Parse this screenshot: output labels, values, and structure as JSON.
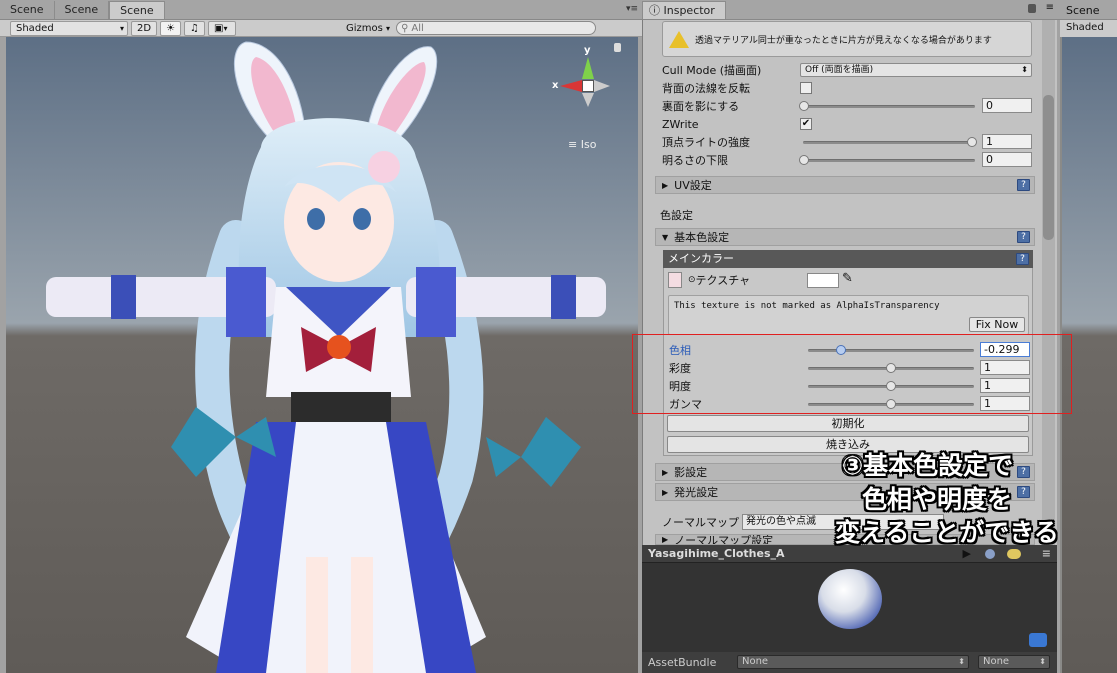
{
  "scene_tabs": [
    "Scene",
    "Scene",
    "Scene"
  ],
  "scene_toolbar": {
    "shading": "Shaded",
    "mode2d": "2D",
    "gizmos": "Gizmos",
    "search_placeholder": "All"
  },
  "gizmo": {
    "y": "y",
    "x": "x",
    "projection": "Iso"
  },
  "inspector": {
    "tab": "Inspector",
    "warning": "透過マテリアル同士が重なったときに片方が見えなくなる場合があります",
    "cull_mode_label": "Cull Mode (描画面)",
    "cull_mode_value": "Off (両面を描画)",
    "backface_normal_label": "背面の法線を反転",
    "shadow_back_label": "裏面を影にする",
    "shadow_back_value": "0",
    "zwrite_label": "ZWrite",
    "vertex_light_label": "頂点ライトの強度",
    "vertex_light_value": "1",
    "min_brightness_label": "明るさの下限",
    "min_brightness_value": "0",
    "uv_section": "UV設定",
    "color_header": "色設定",
    "base_color_section": "基本色設定",
    "main_color_box": "メインカラー",
    "texture_label": "テクスチャ",
    "alpha_warning": "This texture is not marked as AlphaIsTransparency",
    "fix_now": "Fix Now",
    "hue_label": "色相",
    "hue_value": "-0.299",
    "hue_level": 0.2,
    "saturation_label": "彩度",
    "saturation_value": "1",
    "saturation_level": 0.5,
    "brightness_label": "明度",
    "brightness_value": "1",
    "brightness_level": 0.5,
    "gamma_label": "ガンマ",
    "gamma_value": "1",
    "gamma_level": 0.5,
    "reset_button": "初期化",
    "bake_button": "焼き込み",
    "shadow_section": "影設定",
    "emission_section": "発光設定",
    "normal_map_label": "ノーマルマップ",
    "normal_map_value": "発光の色や点滅",
    "normal_map_section": "ノーマルマップ設定"
  },
  "preview": {
    "title": "Yasagihime_Clothes_A",
    "assetbundle_label": "AssetBundle",
    "bundle_value": "None",
    "variant_value": "None"
  },
  "right_scene": {
    "tab": "Scene",
    "shading": "Shaded"
  },
  "annotation": {
    "line1": "③基本色設定で",
    "line2": "色相や明度を",
    "line3": "変えることができる",
    "box_color": "#e02020"
  }
}
